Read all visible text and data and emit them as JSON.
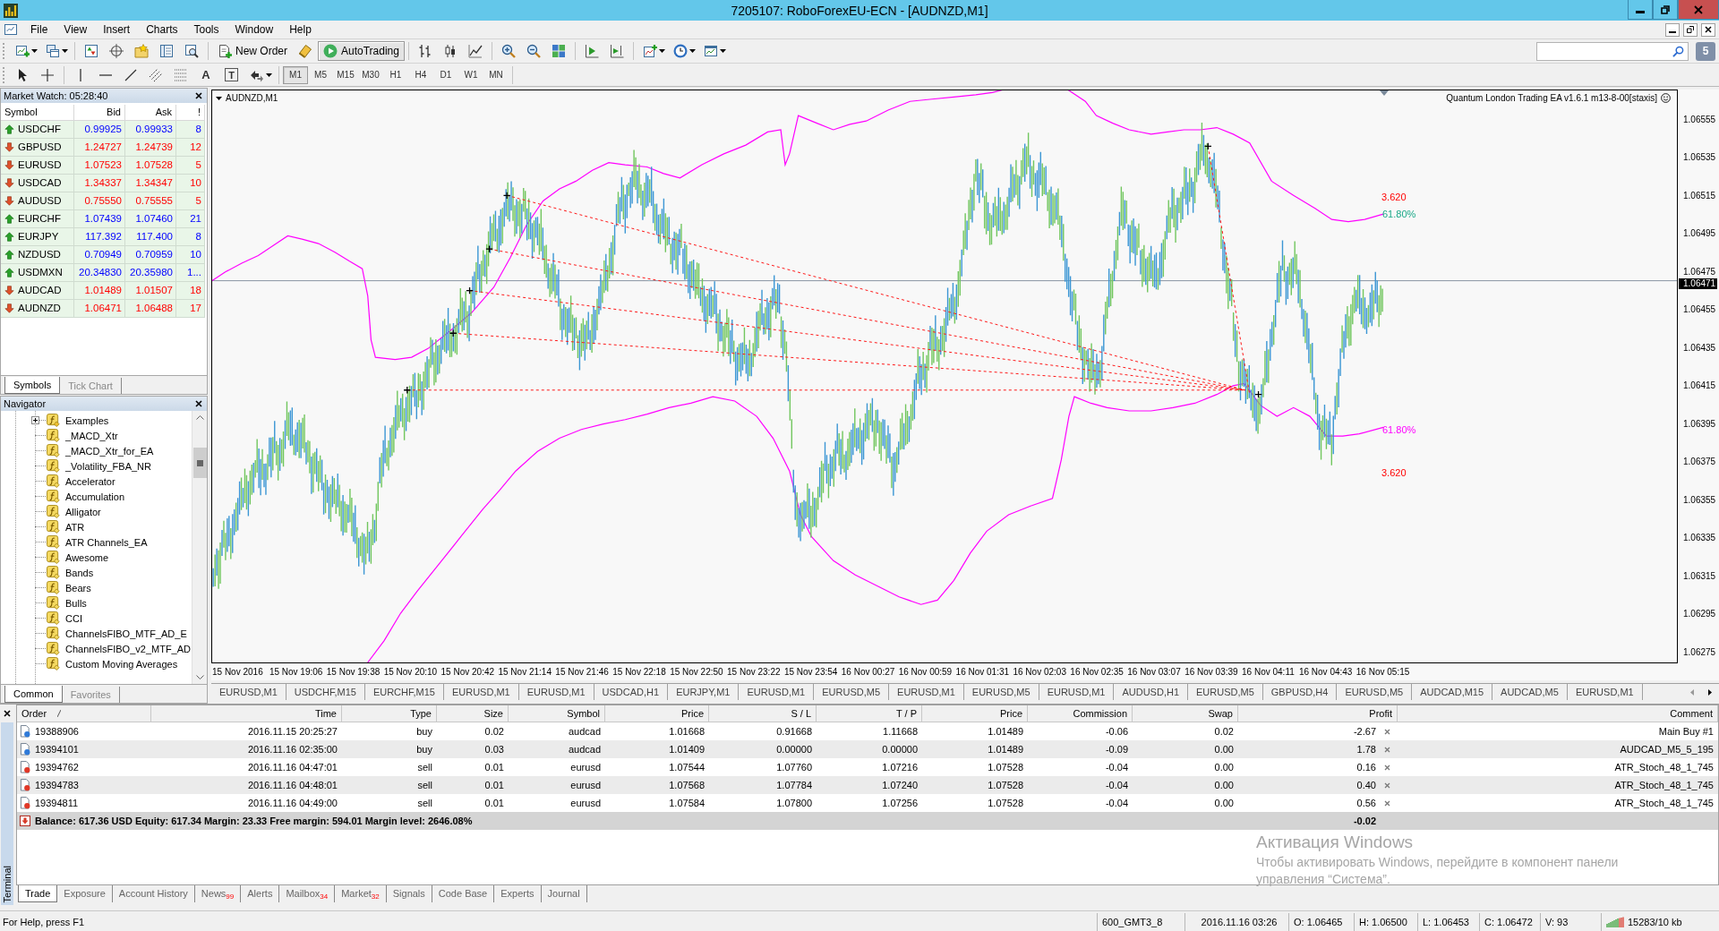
{
  "window": {
    "title": "7205107: RoboForexEU-ECN - [AUDNZD,M1]"
  },
  "menu": [
    "File",
    "View",
    "Insert",
    "Charts",
    "Tools",
    "Window",
    "Help"
  ],
  "toolbar": {
    "new_order": "New Order",
    "autotrading": {
      "label": "AutoTrading",
      "on": true
    },
    "messages_count": "5"
  },
  "drawing_tools": {
    "text_glyph": "A",
    "label_glyph": "T"
  },
  "timeframes": [
    {
      "label": "M1",
      "selected": true
    },
    {
      "label": "M5",
      "selected": false
    },
    {
      "label": "M15",
      "selected": false
    },
    {
      "label": "M30",
      "selected": false
    },
    {
      "label": "H1",
      "selected": false
    },
    {
      "label": "H4",
      "selected": false
    },
    {
      "label": "D1",
      "selected": false
    },
    {
      "label": "W1",
      "selected": false
    },
    {
      "label": "MN",
      "selected": false
    }
  ],
  "market_watch": {
    "title": "Market Watch: 05:28:40",
    "columns": [
      "Symbol",
      "Bid",
      "Ask",
      "!"
    ],
    "rows": [
      {
        "kind": "up",
        "symbol": "USDCHF",
        "bid": "0.99925",
        "ask": "0.99933",
        "spread": "8"
      },
      {
        "kind": "down",
        "symbol": "GBPUSD",
        "bid": "1.24727",
        "ask": "1.24739",
        "spread": "12"
      },
      {
        "kind": "down",
        "symbol": "EURUSD",
        "bid": "1.07523",
        "ask": "1.07528",
        "spread": "5"
      },
      {
        "kind": "down",
        "symbol": "USDCAD",
        "bid": "1.34337",
        "ask": "1.34347",
        "spread": "10"
      },
      {
        "kind": "down",
        "symbol": "AUDUSD",
        "bid": "0.75550",
        "ask": "0.75555",
        "spread": "5"
      },
      {
        "kind": "up",
        "symbol": "EURCHF",
        "bid": "1.07439",
        "ask": "1.07460",
        "spread": "21"
      },
      {
        "kind": "up",
        "symbol": "EURJPY",
        "bid": "117.392",
        "ask": "117.400",
        "spread": "8"
      },
      {
        "kind": "up",
        "symbol": "NZDUSD",
        "bid": "0.70949",
        "ask": "0.70959",
        "spread": "10"
      },
      {
        "kind": "up",
        "symbol": "USDMXN",
        "bid": "20.34830",
        "ask": "20.35980",
        "spread": "1..."
      },
      {
        "kind": "down",
        "symbol": "AUDCAD",
        "bid": "1.01489",
        "ask": "1.01507",
        "spread": "18"
      },
      {
        "kind": "down",
        "symbol": "AUDNZD",
        "bid": "1.06471",
        "ask": "1.06488",
        "spread": "17"
      }
    ],
    "tabs": [
      {
        "label": "Symbols",
        "selected": true
      },
      {
        "label": "Tick Chart",
        "selected": false
      }
    ]
  },
  "navigator": {
    "title": "Navigator",
    "items": [
      {
        "label": "Examples",
        "kind": "folder",
        "expanded": false
      },
      {
        "label": "_MACD_Xtr",
        "kind": "indicator"
      },
      {
        "label": "_MACD_Xtr_for_EA",
        "kind": "indicator"
      },
      {
        "label": "_Volatility_FBA_NR",
        "kind": "indicator"
      },
      {
        "label": "Accelerator",
        "kind": "indicator"
      },
      {
        "label": "Accumulation",
        "kind": "indicator"
      },
      {
        "label": "Alligator",
        "kind": "indicator"
      },
      {
        "label": "ATR",
        "kind": "indicator"
      },
      {
        "label": "ATR Channels_EA",
        "kind": "indicator"
      },
      {
        "label": "Awesome",
        "kind": "indicator"
      },
      {
        "label": "Bands",
        "kind": "indicator"
      },
      {
        "label": "Bears",
        "kind": "indicator"
      },
      {
        "label": "Bulls",
        "kind": "indicator"
      },
      {
        "label": "CCI",
        "kind": "indicator"
      },
      {
        "label": "ChannelsFIBO_MTF_AD_E",
        "kind": "indicator"
      },
      {
        "label": "ChannelsFIBO_v2_MTF_AD",
        "kind": "indicator"
      },
      {
        "label": "Custom Moving Averages",
        "kind": "indicator"
      }
    ],
    "tabs": [
      {
        "label": "Common",
        "selected": true
      },
      {
        "label": "Favorites",
        "selected": false
      }
    ]
  },
  "chart": {
    "symbol": "AUDNZD,M1",
    "expert": "Quantum London Trading EA v1.6.1 m13-8-00[staxis]",
    "levels": [
      {
        "label": "3.620",
        "color": "#ff0000"
      },
      {
        "label": "61.80%",
        "color": "#1aa888"
      },
      {
        "label": "61.80%",
        "color": "#ff00ff"
      },
      {
        "label": "3.620",
        "color": "#ff0000"
      }
    ],
    "price_ticks": [
      "1.06555",
      "1.06535",
      "1.06515",
      "1.06495",
      "1.06475",
      "1.06455",
      "1.06435",
      "1.06415",
      "1.06395",
      "1.06375",
      "1.06355",
      "1.06335",
      "1.06315",
      "1.06295",
      "1.06275"
    ],
    "current_price": "1.06471",
    "time_ticks": [
      "15 Nov 2016",
      "15 Nov 19:06",
      "15 Nov 19:38",
      "15 Nov 20:10",
      "15 Nov 20:42",
      "15 Nov 21:14",
      "15 Nov 21:46",
      "15 Nov 22:18",
      "15 Nov 22:50",
      "15 Nov 23:22",
      "15 Nov 23:54",
      "16 Nov 00:27",
      "16 Nov 00:59",
      "16 Nov 01:31",
      "16 Nov 02:03",
      "16 Nov 02:35",
      "16 Nov 03:07",
      "16 Nov 03:39",
      "16 Nov 04:11",
      "16 Nov 04:43",
      "16 Nov 05:15"
    ]
  },
  "chart_tabs": [
    {
      "label": "EURUSD,M1",
      "selected": false
    },
    {
      "label": "USDCHF,M15",
      "selected": false
    },
    {
      "label": "EURCHF,M15",
      "selected": false
    },
    {
      "label": "EURUSD,M1",
      "selected": false
    },
    {
      "label": "EURUSD,M1",
      "selected": false
    },
    {
      "label": "USDCAD,H1",
      "selected": false
    },
    {
      "label": "EURJPY,M1",
      "selected": false
    },
    {
      "label": "EURUSD,M1",
      "selected": false
    },
    {
      "label": "EURUSD,M5",
      "selected": false
    },
    {
      "label": "EURUSD,M1",
      "selected": false
    },
    {
      "label": "EURUSD,M5",
      "selected": false
    },
    {
      "label": "EURUSD,M1",
      "selected": false
    },
    {
      "label": "AUDUSD,H1",
      "selected": false
    },
    {
      "label": "EURUSD,M5",
      "selected": false
    },
    {
      "label": "GBPUSD,H4",
      "selected": false
    },
    {
      "label": "EURUSD,M5",
      "selected": false
    },
    {
      "label": "AUDCAD,M15",
      "selected": false
    },
    {
      "label": "AUDCAD,M5",
      "selected": false
    },
    {
      "label": "EURUSD,M1",
      "selected": false
    }
  ],
  "terminal": {
    "title": "Terminal",
    "columns": [
      {
        "label": "Order",
        "sorted": true
      },
      {
        "label": "Time",
        "sorted": false
      },
      {
        "label": "Type",
        "sorted": false
      },
      {
        "label": "Size",
        "sorted": false
      },
      {
        "label": "Symbol",
        "sorted": false
      },
      {
        "label": "Price",
        "sorted": false
      },
      {
        "label": "S / L",
        "sorted": false
      },
      {
        "label": "T / P",
        "sorted": false
      },
      {
        "label": "Price",
        "sorted": false
      },
      {
        "label": "Commission",
        "sorted": false
      },
      {
        "label": "Swap",
        "sorted": false
      },
      {
        "label": "Profit",
        "sorted": false
      },
      {
        "label": "Comment",
        "sorted": false
      }
    ],
    "orders": [
      {
        "kind": "buy",
        "order": "19388906",
        "time": "2016.11.15 20:25:27",
        "type": "buy",
        "size": "0.02",
        "symbol": "audcad",
        "price": "1.01668",
        "sl": "0.91668",
        "tp": "1.11668",
        "price_now": "1.01489",
        "commission": "-0.06",
        "swap": "0.02",
        "profit": "-2.67",
        "comment": "Main Buy #1"
      },
      {
        "kind": "buy",
        "order": "19394101",
        "time": "2016.11.16 02:35:00",
        "type": "buy",
        "size": "0.03",
        "symbol": "audcad",
        "price": "1.01409",
        "sl": "0.00000",
        "tp": "0.00000",
        "price_now": "1.01489",
        "commission": "-0.09",
        "swap": "0.00",
        "profit": "1.78",
        "comment": "AUDCAD_M5_5_195"
      },
      {
        "kind": "sell",
        "order": "19394762",
        "time": "2016.11.16 04:47:01",
        "type": "sell",
        "size": "0.01",
        "symbol": "eurusd",
        "price": "1.07544",
        "sl": "1.07760",
        "tp": "1.07216",
        "price_now": "1.07528",
        "commission": "-0.04",
        "swap": "0.00",
        "profit": "0.16",
        "comment": "ATR_Stoch_48_1_745"
      },
      {
        "kind": "sell",
        "order": "19394783",
        "time": "2016.11.16 04:48:01",
        "type": "sell",
        "size": "0.01",
        "symbol": "eurusd",
        "price": "1.07568",
        "sl": "1.07784",
        "tp": "1.07240",
        "price_now": "1.07528",
        "commission": "-0.04",
        "swap": "0.00",
        "profit": "0.40",
        "comment": "ATR_Stoch_48_1_745"
      },
      {
        "kind": "sell",
        "order": "19394811",
        "time": "2016.11.16 04:49:00",
        "type": "sell",
        "size": "0.01",
        "symbol": "eurusd",
        "price": "1.07584",
        "sl": "1.07800",
        "tp": "1.07256",
        "price_now": "1.07528",
        "commission": "-0.04",
        "swap": "0.00",
        "profit": "0.56",
        "comment": "ATR_Stoch_48_1_745"
      }
    ],
    "summary": {
      "text": "Balance: 617.36 USD  Equity: 617.34  Margin: 23.33  Free margin: 594.01  Margin level: 2646.08%",
      "profit": "-0.02"
    },
    "tabs": [
      {
        "label": "Trade",
        "selected": true
      },
      {
        "label": "Exposure",
        "selected": false
      },
      {
        "label": "Account History",
        "selected": false
      },
      {
        "label": "News",
        "badge": "99",
        "selected": false
      },
      {
        "label": "Alerts",
        "selected": false
      },
      {
        "label": "Mailbox",
        "badge": "34",
        "selected": false
      },
      {
        "label": "Market",
        "badge": "32",
        "selected": false
      },
      {
        "label": "Signals",
        "selected": false
      },
      {
        "label": "Code Base",
        "selected": false
      },
      {
        "label": "Experts",
        "selected": false
      },
      {
        "label": "Journal",
        "selected": false
      }
    ]
  },
  "os_notice": {
    "title": "Активация Windows",
    "text": "Чтобы активировать Windows, перейдите в компонент панели управления “Система”."
  },
  "status_bar": {
    "help": "For Help, press F1",
    "profile": "600_GMT3_8",
    "datetime": "2016.11.16 03:26",
    "open": "O: 1.06465",
    "high": "H: 1.06500",
    "low": "L: 1.06453",
    "close": "C: 1.06472",
    "volume": "V: 93",
    "traffic": "15283/10 kb"
  }
}
